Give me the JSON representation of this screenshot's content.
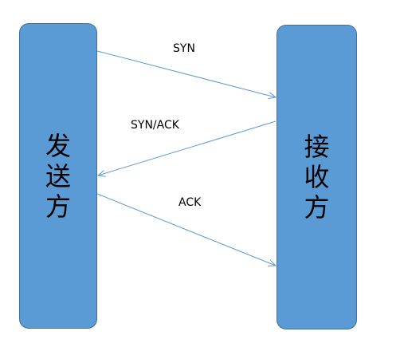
{
  "diagram": {
    "sender_label": "发送方",
    "receiver_label": "接收方",
    "messages": [
      {
        "label": "SYN",
        "from": "sender",
        "to": "receiver"
      },
      {
        "label": "SYN/ACK",
        "from": "receiver",
        "to": "sender"
      },
      {
        "label": "ACK",
        "from": "sender",
        "to": "receiver"
      }
    ],
    "colors": {
      "box_fill": "#5b9bd5",
      "box_border": "#41719c",
      "arrow": "#5b9bd5"
    }
  }
}
